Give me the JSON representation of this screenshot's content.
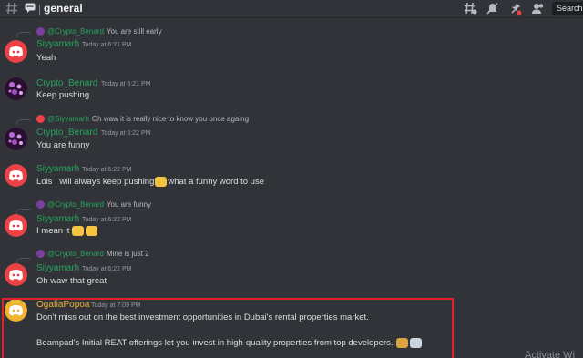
{
  "header": {
    "channel_separator": "|",
    "channel_name": "general",
    "search_label": "Search",
    "icons": [
      "hash-icon",
      "thread-icon",
      "threads-icon",
      "mute-icon",
      "pin-icon",
      "members-icon"
    ]
  },
  "messages": [
    {
      "reply": {
        "name": "@Crypto_Benard",
        "text": "You are still early"
      },
      "author": "Siyyamarh",
      "time": "Today at 6:21 PM",
      "text": "Yeah"
    },
    {
      "author": "Crypto_Benard",
      "time": "Today at 6:21 PM",
      "text": "Keep pushing"
    },
    {
      "reply": {
        "name": "@Siyyamarh",
        "text": "Oh waw it is really nice to know you once againg"
      },
      "author": "Crypto_Benard",
      "time": "Today at 6:22 PM",
      "text": "You are funny"
    },
    {
      "author": "Siyyamarh",
      "time": "Today at 6:22 PM",
      "text_before": "Lols I will always keep pushing",
      "text_after": "what a funny word to use"
    },
    {
      "reply": {
        "name": "@Crypto_Benard",
        "text": "You are funny"
      },
      "author": "Siyyamarh",
      "time": "Today at 6:22 PM",
      "text": "I mean it"
    },
    {
      "reply": {
        "name": "@Crypto_Benard",
        "text": "Mine is just 2"
      },
      "author": "Siyyamarh",
      "time": "Today at 6:22 PM",
      "text": "Oh waw that great"
    },
    {
      "author": "OgafiaPopoa",
      "time": "Today at 7:09 PM",
      "line1": "Don't miss out on the best investment opportunities in Dubai's rental properties market.",
      "line2": "Beampad's Initial REAT offerings let you invest in high-quality properties from top developers."
    }
  ],
  "watermark": "Activate Wi",
  "colors": {
    "background": "#313338",
    "username_green": "#23a55a",
    "username_yellow": "#f0b232",
    "discord_blurple_red": "#ed4245",
    "highlight_border": "#e0222a"
  }
}
